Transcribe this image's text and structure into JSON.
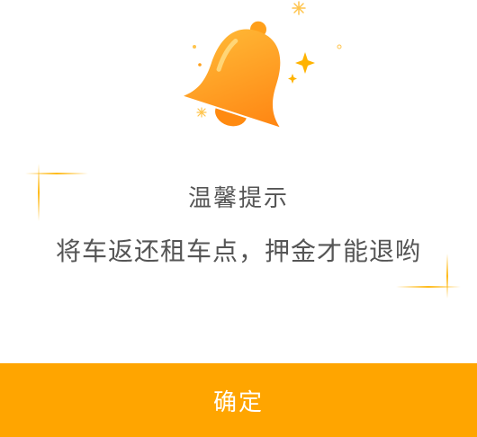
{
  "dialog": {
    "title": "温馨提示",
    "message": "将车返还租车点，押金才能退哟",
    "confirm_label": "确定",
    "icon": "bell-icon"
  },
  "colors": {
    "accent": "#ffa500",
    "bell_light": "#ffb321",
    "bell_dark": "#ff8a10",
    "sparkle": "#ffb300",
    "text": "#555555"
  }
}
